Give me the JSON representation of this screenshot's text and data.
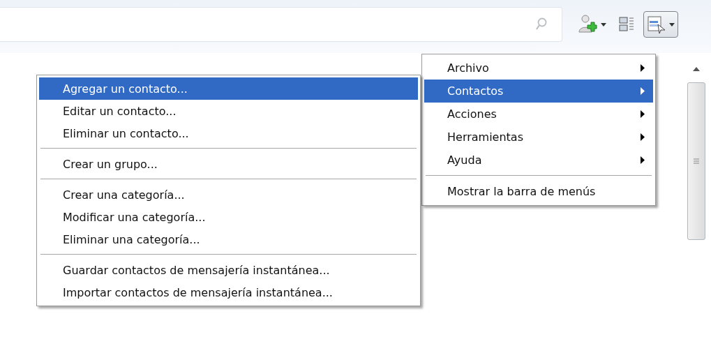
{
  "main_menu": {
    "groups": [
      [
        {
          "label": "Archivo",
          "submenu": true,
          "selected": false
        },
        {
          "label": "Contactos",
          "submenu": true,
          "selected": true
        },
        {
          "label": "Acciones",
          "submenu": true,
          "selected": false
        },
        {
          "label": "Herramientas",
          "submenu": true,
          "selected": false
        },
        {
          "label": "Ayuda",
          "submenu": true,
          "selected": false
        }
      ],
      [
        {
          "label": "Mostrar la barra de menús",
          "submenu": false,
          "selected": false
        }
      ]
    ]
  },
  "submenu": {
    "groups": [
      [
        {
          "label": "Agregar un contacto...",
          "selected": true
        },
        {
          "label": "Editar un contacto...",
          "selected": false
        },
        {
          "label": "Eliminar un contacto...",
          "selected": false
        }
      ],
      [
        {
          "label": "Crear un grupo...",
          "selected": false
        }
      ],
      [
        {
          "label": "Crear una categoría...",
          "selected": false
        },
        {
          "label": "Modificar una categoría...",
          "selected": false
        },
        {
          "label": "Eliminar una categoría...",
          "selected": false
        }
      ],
      [
        {
          "label": "Guardar contactos de mensajería instantánea...",
          "selected": false
        },
        {
          "label": "Importar contactos de mensajería instantánea...",
          "selected": false
        }
      ]
    ]
  }
}
